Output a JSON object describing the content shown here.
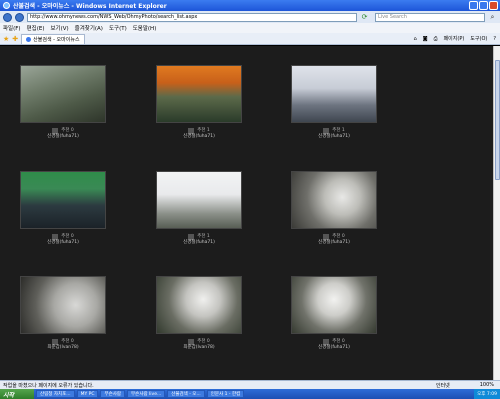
{
  "window": {
    "title": "산불검색 - 오마이뉴스 - Windows Internet Explorer"
  },
  "address": {
    "url": "http://www.ohmynews.com/NWS_Web/OhmyPhoto/search_list.aspx",
    "search_placeholder": "Live Search"
  },
  "menu": [
    "파일(F)",
    "편집(E)",
    "보기(V)",
    "즐겨찾기(A)",
    "도구(T)",
    "도움말(H)"
  ],
  "tab": {
    "label": "산불검색 - 오마이뉴스"
  },
  "commands": {
    "page": "페이지(P)",
    "tools": "도구(O)"
  },
  "photos": [
    {
      "views": "추천 0",
      "author": "신경철(fuha71)"
    },
    {
      "views": "추천 1",
      "author": "신경철(fuha71)"
    },
    {
      "views": "추천 1",
      "author": "신경철(fuha71)"
    },
    {
      "views": "추천 0",
      "author": "신경철(fuha71)"
    },
    {
      "views": "추천 1",
      "author": "신경철(fuha71)"
    },
    {
      "views": "추천 0",
      "author": "신경철(fuha71)"
    },
    {
      "views": "추천 0",
      "author": "최준갑(Ivan78)"
    },
    {
      "views": "추천 0",
      "author": "최준갑(Ivan78)"
    },
    {
      "views": "추천 0",
      "author": "신경철(fuha71)"
    }
  ],
  "status": {
    "message": "작업을 마쳤으나 페이지에 오류가 있습니다.",
    "zone": "인터넷",
    "zoom": "100%"
  },
  "taskbar": {
    "start": "시작",
    "tasks": [
      "산림청 자치포...",
      "MY PC",
      "무슨사람",
      "무슨사람 live...",
      "산불검색 - 오...",
      "인문사 1 - 한컴"
    ],
    "clock": "오후 7:09"
  }
}
